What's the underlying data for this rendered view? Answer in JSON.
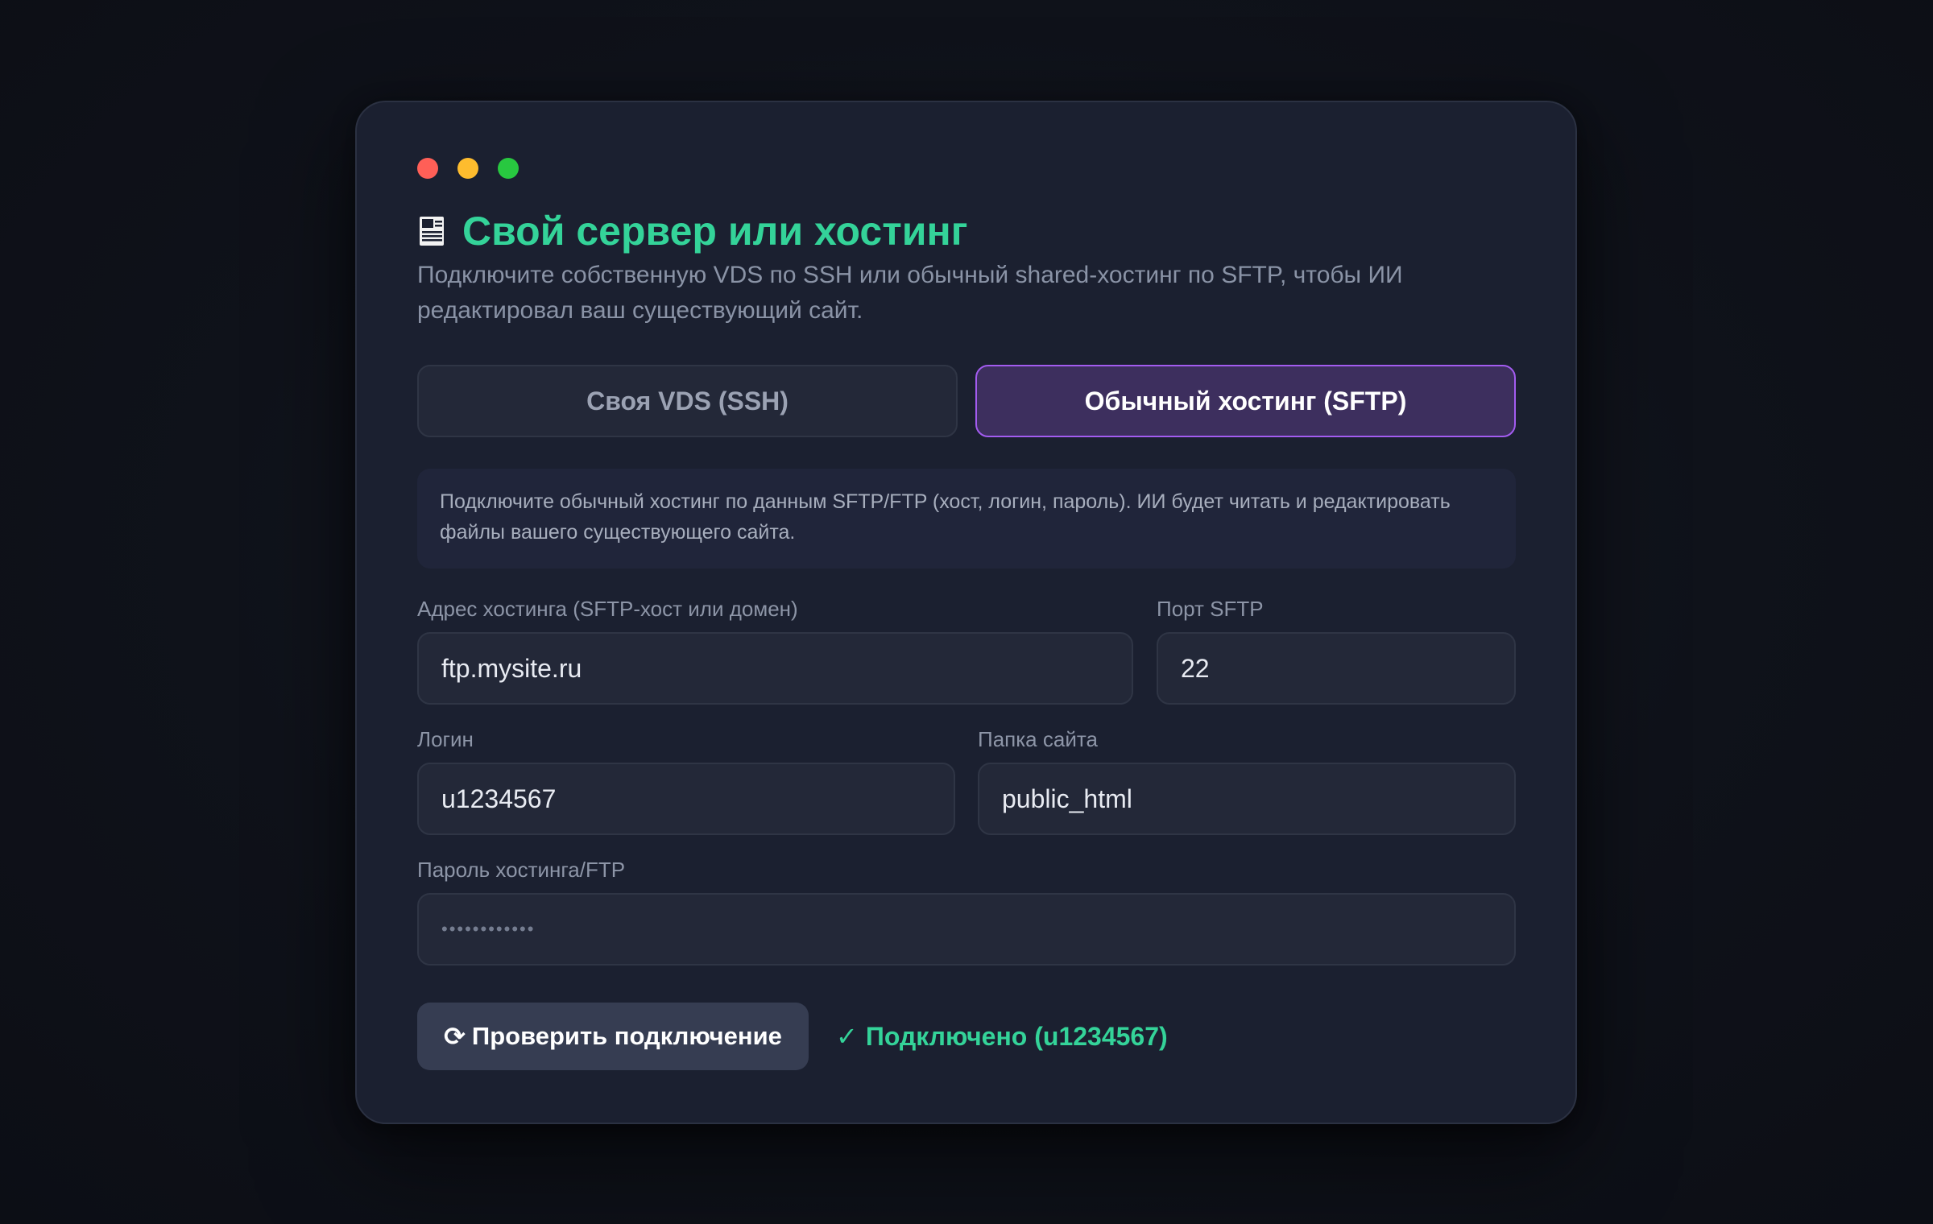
{
  "header": {
    "title": "Свой сервер или хостинг",
    "subtitle": "Подключите собственную VDS по SSH или обычный shared-хостинг по SFTP, чтобы ИИ редактировал ваш существующий сайт."
  },
  "tabs": [
    {
      "label": "Своя VDS (SSH)",
      "active": false
    },
    {
      "label": "Обычный хостинг (SFTP)",
      "active": true
    }
  ],
  "info": {
    "text": "Подключите обычный хостинг по данным SFTP/FTP (хост, логин, пароль). ИИ будет читать и редактировать файлы вашего существующего сайта."
  },
  "form": {
    "host": {
      "label": "Адрес хостинга (SFTP-хост или домен)",
      "value": "ftp.mysite.ru"
    },
    "port": {
      "label": "Порт SFTP",
      "value": "22"
    },
    "login": {
      "label": "Логин",
      "value": "u1234567"
    },
    "folder": {
      "label": "Папка сайта",
      "value": "public_html"
    },
    "password": {
      "label": "Пароль хостинга/FTP",
      "value": "••••••••••••"
    }
  },
  "actions": {
    "check_icon": "⟳",
    "check_label": "Проверить подключение",
    "status_icon": "✓",
    "status_text": "Подключено (u1234567)"
  },
  "colors": {
    "accent_green": "#34d399",
    "active_tab_border": "#a35cf0",
    "active_tab_bg": "#3d2f5e",
    "traffic_red": "#ff5f57",
    "traffic_yellow": "#febc2e",
    "traffic_green": "#28c840"
  },
  "icons": {
    "title_icon": "server-icon",
    "check_icon": "refresh-icon",
    "status_icon": "checkmark-icon"
  }
}
